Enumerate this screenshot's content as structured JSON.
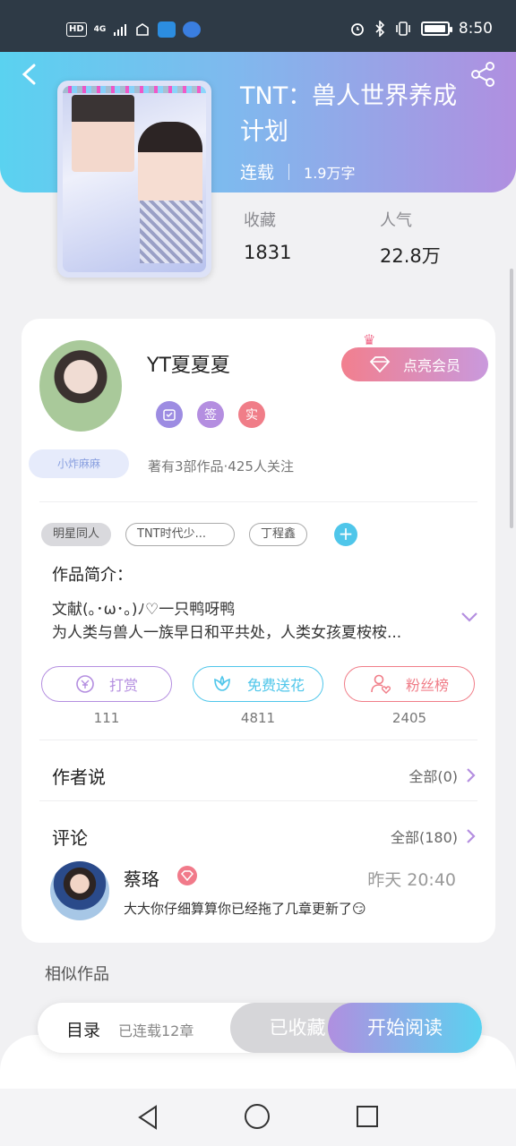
{
  "status_bar": {
    "hd": "HD",
    "network": "4G",
    "time": "8:50"
  },
  "book": {
    "title": "TNT：兽人世界养成计划",
    "status": "连载",
    "word_count": "1.9万字",
    "favorites_label": "收藏",
    "favorites_value": "1831",
    "popularity_label": "人气",
    "popularity_value": "22.8万"
  },
  "author": {
    "name": "YT夏夏夏",
    "fan_tag": "小炸麻麻",
    "badges": [
      "签",
      "实"
    ],
    "stats": "著有3部作品·425人关注",
    "vip_button": "点亮会员"
  },
  "tags": [
    "明星同人",
    "TNT时代少...",
    "丁程鑫"
  ],
  "intro": {
    "title": "作品简介：",
    "line1": "文献(｡･ω･｡)ﾉ♡一只鸭呀鸭",
    "line2": "为人类与兽人一族早日和平共处，人类女孩夏桉桉..."
  },
  "actions": [
    {
      "label": "打赏",
      "count": "111",
      "color": "#b48ee0"
    },
    {
      "label": "免费送花",
      "count": "4811",
      "color": "#4fc6ea"
    },
    {
      "label": "粉丝榜",
      "count": "2405",
      "color": "#f07d88"
    }
  ],
  "author_says": {
    "title": "作者说",
    "more": "全部(0)"
  },
  "comments": {
    "title": "评论",
    "more": "全部(180)",
    "first": {
      "user": "蔡珞",
      "time": "昨天 20:40",
      "text": "大大你仔细算算你已经拖了几章更新了😏"
    }
  },
  "similar_title": "相似作品",
  "bottom_bar": {
    "toc": "目录",
    "chapters": "已连载12章",
    "favorited": "已收藏",
    "read": "开始阅读"
  }
}
